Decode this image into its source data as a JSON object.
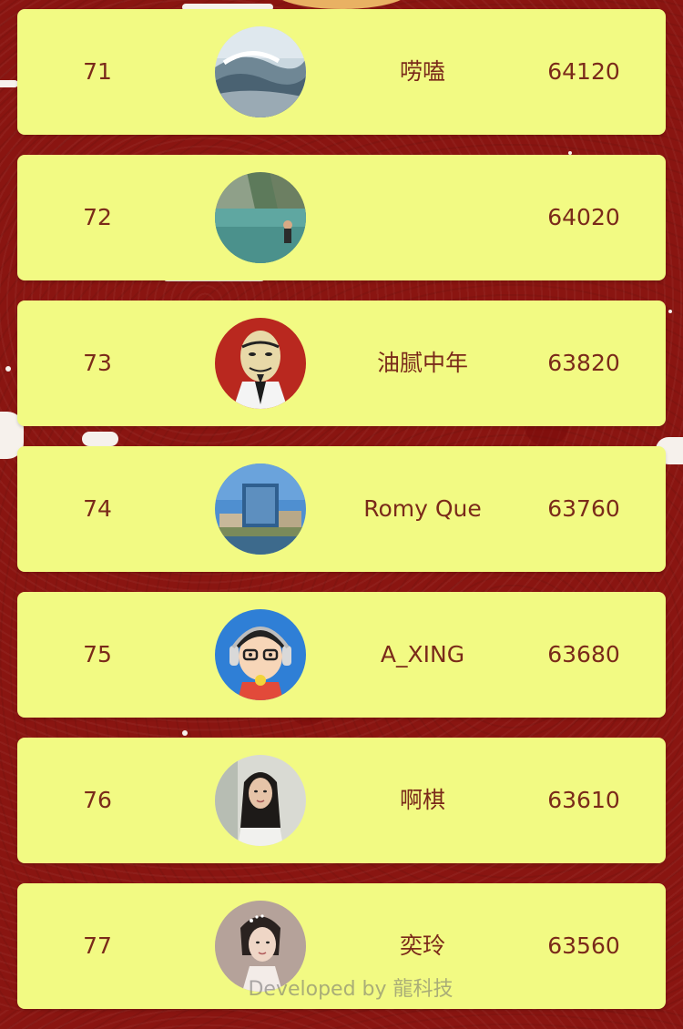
{
  "rows": [
    {
      "rank": "71",
      "name": "唠嗑",
      "score": "64120",
      "avatar": "ocean-wave-avatar"
    },
    {
      "rank": "72",
      "name": "",
      "score": "64020",
      "avatar": "lagoon-swimmer-avatar"
    },
    {
      "rank": "73",
      "name": "油腻中年",
      "score": "63820",
      "avatar": "masked-colonel-avatar"
    },
    {
      "rank": "74",
      "name": "Romy Que",
      "score": "63760",
      "avatar": "city-tower-avatar"
    },
    {
      "rank": "75",
      "name": "A_XING",
      "score": "63680",
      "avatar": "cartoon-headphones-avatar"
    },
    {
      "rank": "76",
      "name": "啊棋",
      "score": "63610",
      "avatar": "woman-portrait-avatar"
    },
    {
      "rank": "77",
      "name": "奕玲",
      "score": "63560",
      "avatar": "bride-portrait-avatar"
    }
  ],
  "footer": {
    "credit": "Developed by 龍科技"
  },
  "colors": {
    "background": "#8a1511",
    "row_background": "#f2fa83",
    "text": "#7a2a1a"
  }
}
